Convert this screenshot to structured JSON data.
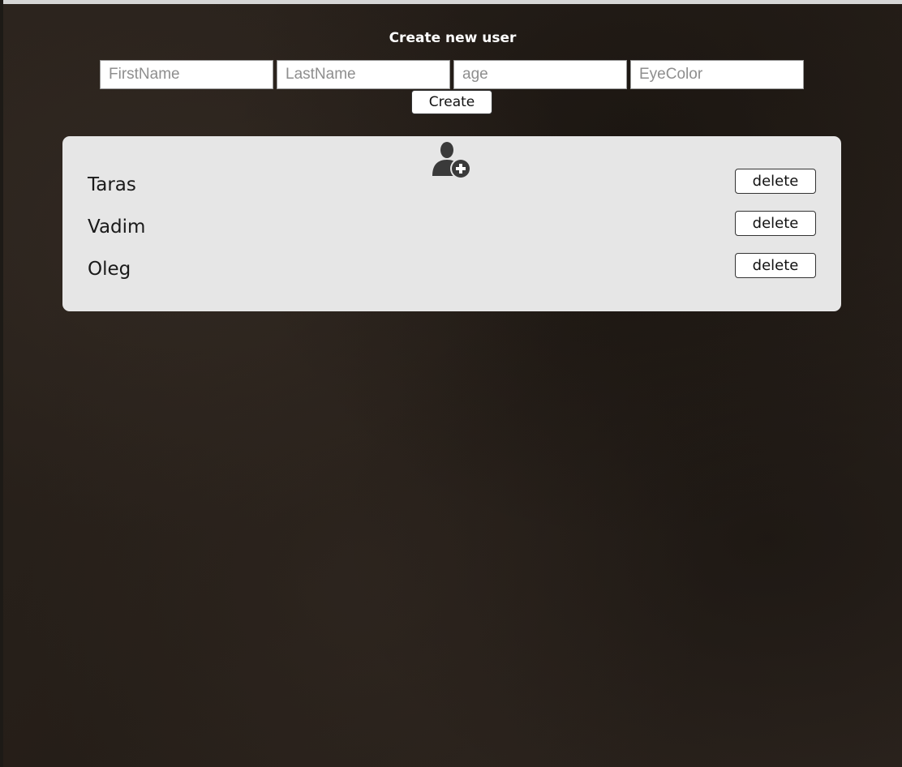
{
  "form": {
    "title": "Create new user",
    "fields": {
      "first_name": {
        "placeholder": "FirstName",
        "value": ""
      },
      "last_name": {
        "placeholder": "LastName",
        "value": ""
      },
      "age": {
        "placeholder": "age",
        "value": ""
      },
      "eye_color": {
        "placeholder": "EyeColor",
        "value": ""
      }
    },
    "create_label": "Create"
  },
  "panel": {
    "icon": "add-user-icon",
    "users": [
      {
        "name": "Taras",
        "delete_label": "delete"
      },
      {
        "name": "Vadim",
        "delete_label": "delete"
      },
      {
        "name": "Oleg",
        "delete_label": "delete"
      }
    ]
  },
  "colors": {
    "background": "#2a221c",
    "panel": "#e6e6e6",
    "title_text": "#ffffff",
    "icon": "#3a3a3a"
  }
}
